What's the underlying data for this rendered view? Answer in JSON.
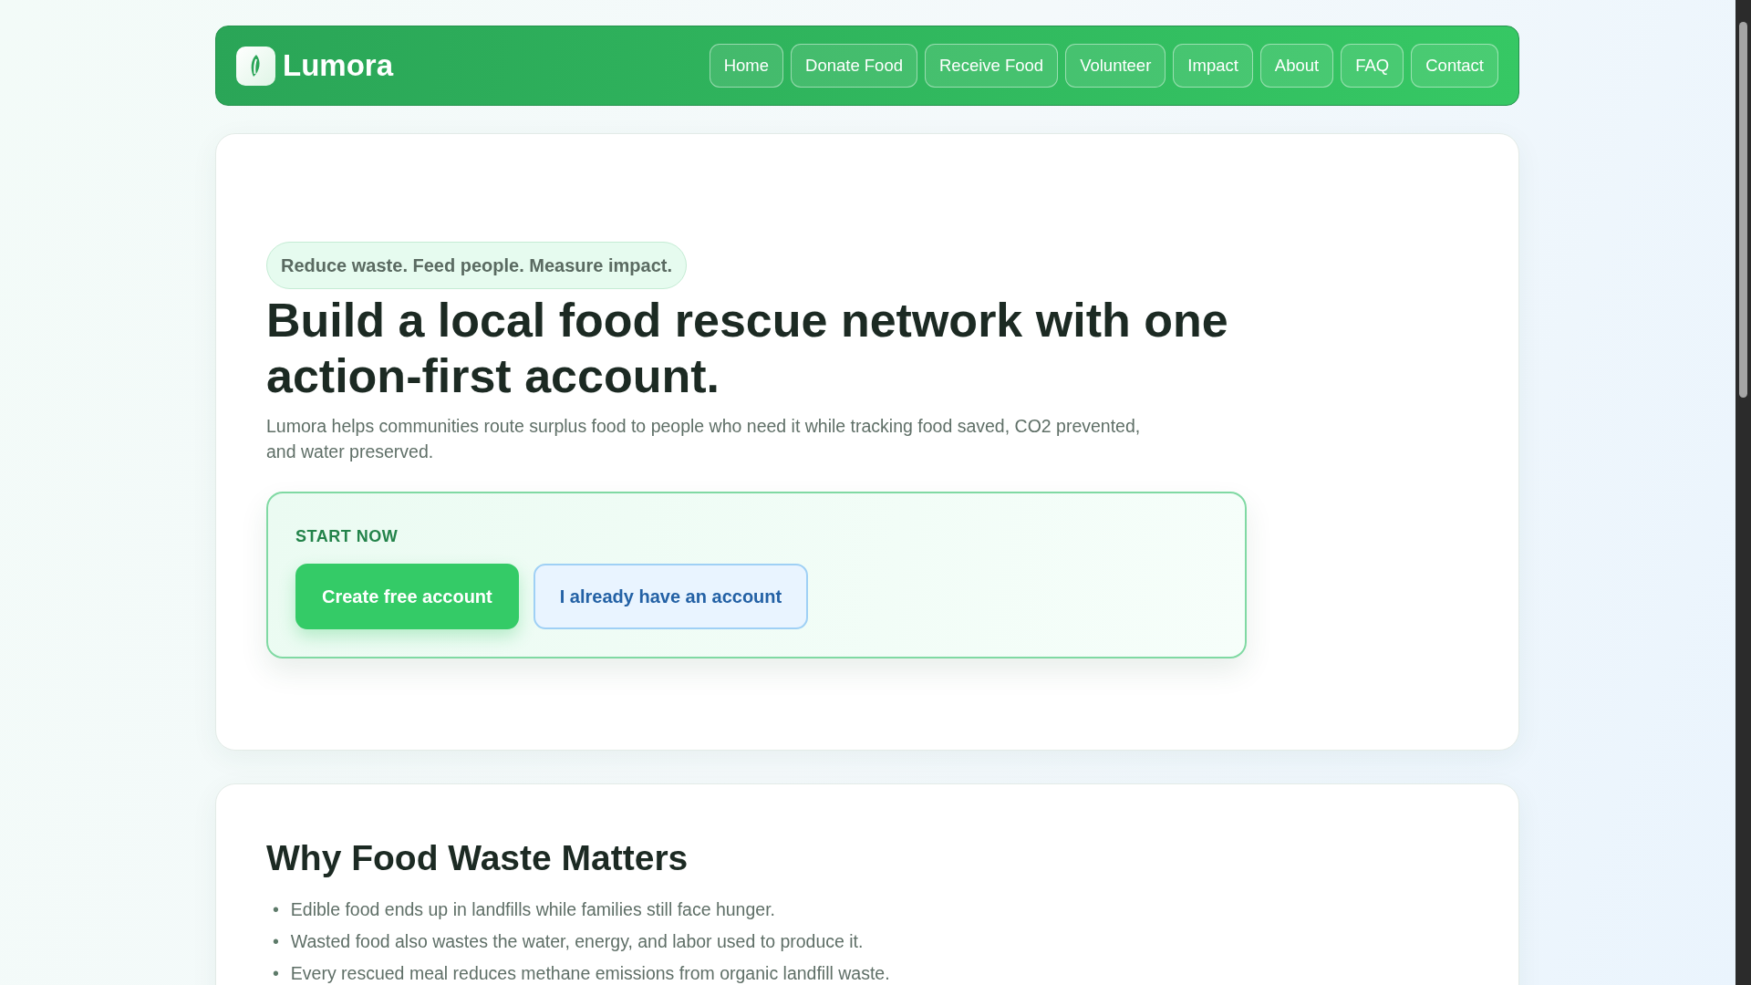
{
  "brand": {
    "name": "Lumora"
  },
  "nav": [
    {
      "label": "Home"
    },
    {
      "label": "Donate Food"
    },
    {
      "label": "Receive Food"
    },
    {
      "label": "Volunteer"
    },
    {
      "label": "Impact"
    },
    {
      "label": "About"
    },
    {
      "label": "FAQ"
    },
    {
      "label": "Contact"
    }
  ],
  "hero": {
    "tagline": "Reduce waste. Feed people. Measure impact.",
    "title": "Build a local food rescue network with one action-first account.",
    "lead": "Lumora helps communities route surplus food to people who need it while tracking food saved, CO2 prevented, and water preserved.",
    "cta": {
      "label": "START NOW",
      "buttons": [
        {
          "label": "Create free account",
          "kind": "primary"
        },
        {
          "label": "I already have an account",
          "kind": "secondary"
        }
      ]
    }
  },
  "why": {
    "title": "Why Food Waste Matters",
    "items": [
      {
        "bullet": "•",
        "text": "Edible food ends up in landfills while families still face hunger."
      },
      {
        "bullet": "•",
        "text": "Wasted food also wastes the water, energy, and labor used to produce it."
      },
      {
        "bullet": "•",
        "text": "Every rescued meal reduces methane emissions from organic landfill waste."
      }
    ]
  }
}
